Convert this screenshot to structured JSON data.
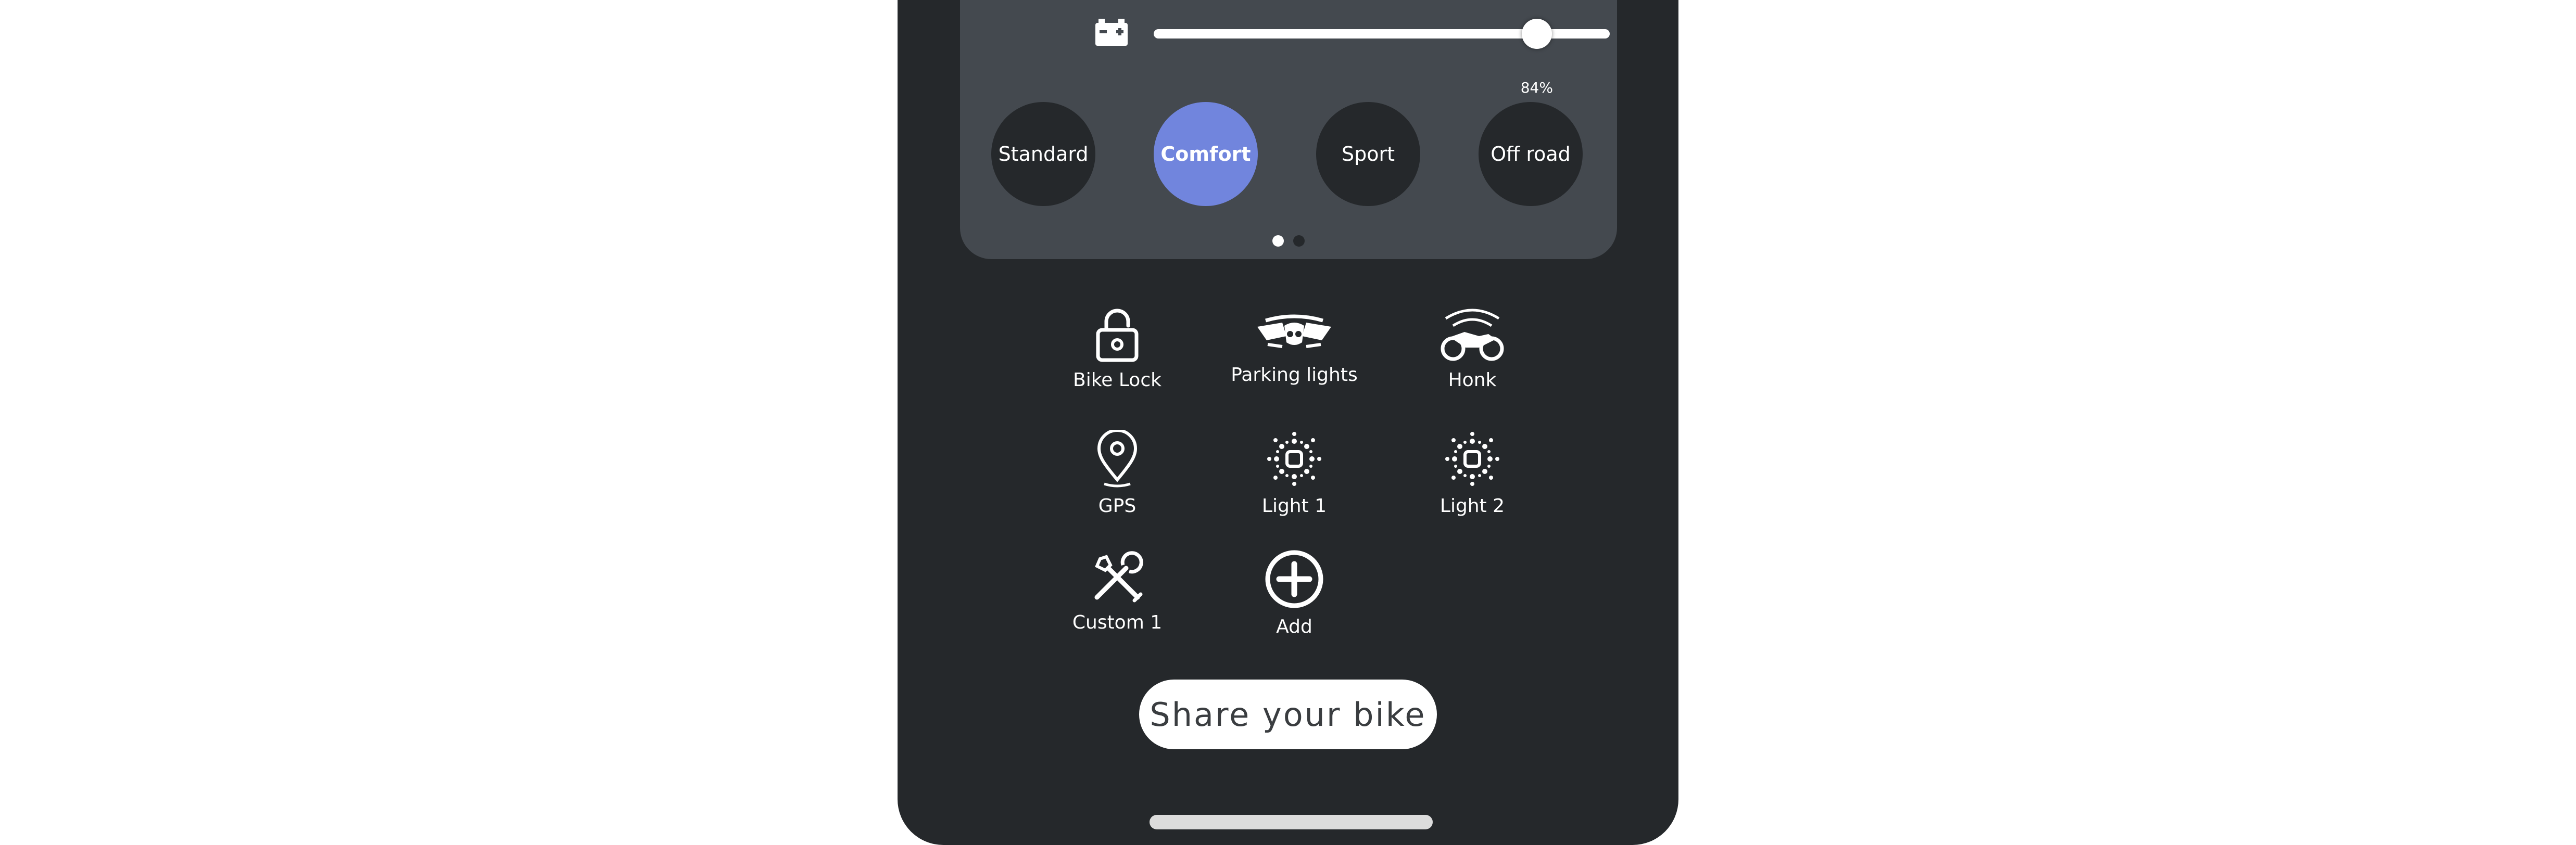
{
  "battery": {
    "icon": "battery-icon",
    "level_percent": 84,
    "label": "84%"
  },
  "modes": [
    {
      "label": "Standard",
      "active": false
    },
    {
      "label": "Comfort",
      "active": true
    },
    {
      "label": "Sport",
      "active": false
    },
    {
      "label": "Off road",
      "active": false
    }
  ],
  "page_indicator": {
    "pages": 2,
    "current": 1
  },
  "actions": [
    {
      "label": "Bike Lock",
      "icon": "lock-icon"
    },
    {
      "label": "Parking lights",
      "icon": "parking-lights-icon"
    },
    {
      "label": "Honk",
      "icon": "honk-icon"
    },
    {
      "label": "GPS",
      "icon": "location-pin-icon"
    },
    {
      "label": "Light 1",
      "icon": "light-icon"
    },
    {
      "label": "Light 2",
      "icon": "light-icon"
    },
    {
      "label": "Custom 1",
      "icon": "tools-icon"
    },
    {
      "label": "Add",
      "icon": "add-circle-icon"
    }
  ],
  "share_button": {
    "label": "Share your bike"
  },
  "colors": {
    "background": "#25282b",
    "card": "#44494f",
    "accent": "#7185dd",
    "foreground": "#ffffff"
  }
}
